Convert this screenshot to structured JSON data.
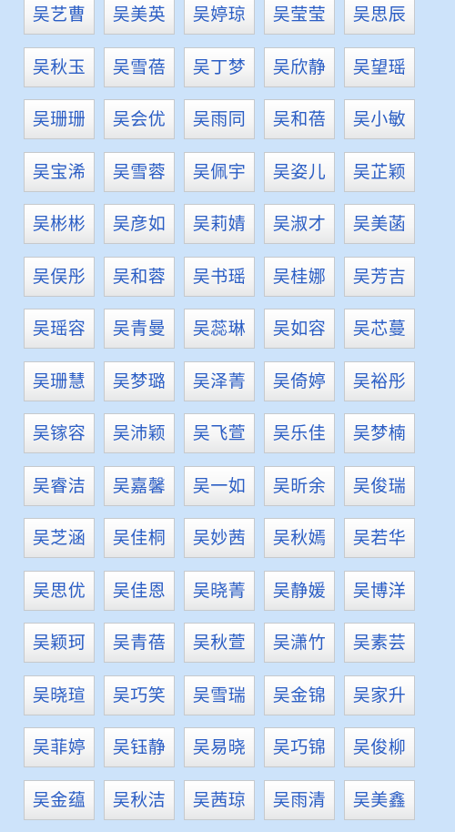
{
  "colors": {
    "background": "#cde3fa",
    "button_text": "#2a5dc4",
    "button_border": "#c6c9cc"
  },
  "names": [
    [
      "吴艺曹",
      "吴美英",
      "吴婷琼",
      "吴莹莹",
      "吴思辰"
    ],
    [
      "吴秋玉",
      "吴雪蓓",
      "吴丁梦",
      "吴欣静",
      "吴望瑶"
    ],
    [
      "吴珊珊",
      "吴会优",
      "吴雨同",
      "吴和蓓",
      "吴小敏"
    ],
    [
      "吴宝浠",
      "吴雪蓉",
      "吴佩宇",
      "吴姿儿",
      "吴芷颖"
    ],
    [
      "吴彬彬",
      "吴彦如",
      "吴莉婧",
      "吴淑才",
      "吴美菡"
    ],
    [
      "吴俣彤",
      "吴和蓉",
      "吴书瑶",
      "吴桂娜",
      "吴芳吉"
    ],
    [
      "吴瑶容",
      "吴青曼",
      "吴蕊琳",
      "吴如容",
      "吴芯蔓"
    ],
    [
      "吴珊慧",
      "吴梦璐",
      "吴泽菁",
      "吴倚婷",
      "吴裕彤"
    ],
    [
      "吴镓容",
      "吴沛颖",
      "吴飞萱",
      "吴乐佳",
      "吴梦楠"
    ],
    [
      "吴睿洁",
      "吴嘉馨",
      "吴一如",
      "吴昕余",
      "吴俊瑞"
    ],
    [
      "吴芝涵",
      "吴佳桐",
      "吴妙茜",
      "吴秋嫣",
      "吴若华"
    ],
    [
      "吴思优",
      "吴佳恩",
      "吴晓菁",
      "吴静媛",
      "吴博洋"
    ],
    [
      "吴颖珂",
      "吴青蓓",
      "吴秋萱",
      "吴潇竹",
      "吴素芸"
    ],
    [
      "吴晓瑄",
      "吴巧笑",
      "吴雪瑞",
      "吴金锦",
      "吴家升"
    ],
    [
      "吴菲婷",
      "吴钰静",
      "吴易晓",
      "吴巧锦",
      "吴俊柳"
    ],
    [
      "吴金蕴",
      "吴秋洁",
      "吴茜琼",
      "吴雨清",
      "吴美鑫"
    ]
  ]
}
